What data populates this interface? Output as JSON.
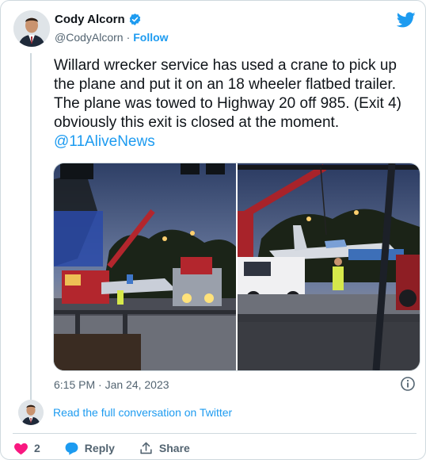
{
  "author": {
    "display_name": "Cody Alcorn",
    "handle": "@CodyAlcorn",
    "separator": "·",
    "follow_label": "Follow"
  },
  "tweet": {
    "text": "Willard wrecker service has used a crane to pick up the plane and put it on an 18 wheeler flatbed trailer. The plane was towed to Highway 20 off 985. (Exit 4) obviously this exit is closed at the moment.",
    "mention": "@11AliveNews",
    "timestamp": "6:15 PM · Jan 24, 2023"
  },
  "footer": {
    "read_conversation": "Read the full conversation on Twitter",
    "like_count": "2",
    "reply_label": "Reply",
    "share_label": "Share"
  },
  "icons": {
    "verified": "verified-badge-icon",
    "brand": "twitter-bird-icon",
    "info": "info-icon",
    "like": "heart-icon",
    "reply": "reply-bubble-icon",
    "share": "share-upload-icon"
  },
  "colors": {
    "accent": "#1d9bf0",
    "like": "#f91880",
    "text_primary": "#0f1419",
    "text_secondary": "#536471",
    "border": "#cfd9de"
  }
}
